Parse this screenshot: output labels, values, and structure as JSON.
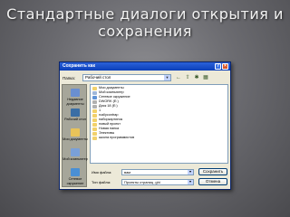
{
  "slide": {
    "title_line1": "Стандартные диалоги открытия и",
    "title_line2": "сохранения"
  },
  "dialog": {
    "title": "Сохранить как",
    "lookin_label": "Папка:",
    "lookin_value": "Рабочий стол",
    "places": [
      {
        "label": "Недавние документы",
        "icon": "recent-documents-icon",
        "color": "#6a8fd0"
      },
      {
        "label": "Рабочий стол",
        "icon": "desktop-icon",
        "color": "#3a6ea5"
      },
      {
        "label": "Мои документы",
        "icon": "my-documents-icon",
        "color": "#e8c35a"
      },
      {
        "label": "Мой компьютер",
        "icon": "my-computer-icon",
        "color": "#7aa0d8"
      },
      {
        "label": "Сетевое окружение",
        "icon": "network-icon",
        "color": "#4a8fd4"
      }
    ],
    "files": [
      {
        "name": "Мои документы",
        "icon": "folder-icon"
      },
      {
        "name": "Мой компьютер",
        "icon": "computer-icon"
      },
      {
        "name": "Сетевое окружение",
        "icon": "network-icon"
      },
      {
        "name": "DWORK (E:)",
        "icon": "drive-icon"
      },
      {
        "name": "Диск 18 (E:)",
        "icon": "drive-icon"
      },
      {
        "name": "1",
        "icon": "folder-icon"
      },
      {
        "name": "rcallycontrap",
        "icon": "folder-icon"
      },
      {
        "name": "наборкартинок",
        "icon": "folder-icon"
      },
      {
        "name": "новый проект",
        "icon": "folder-icon"
      },
      {
        "name": "Новая папка",
        "icon": "folder-icon"
      },
      {
        "name": "Элективы",
        "icon": "folder-icon"
      },
      {
        "name": "школа программистов",
        "icon": "folder-icon"
      }
    ],
    "filename_label": "Имя файла:",
    "filename_value": "вам",
    "filetype_label": "Тип файла:",
    "filetype_value": "Проекты страниц .ghi",
    "save_label": "Сохранить",
    "cancel_label": "Отмена"
  },
  "colors": {
    "title_bar": "#0b3fb9",
    "folder": "#f2d16b"
  }
}
